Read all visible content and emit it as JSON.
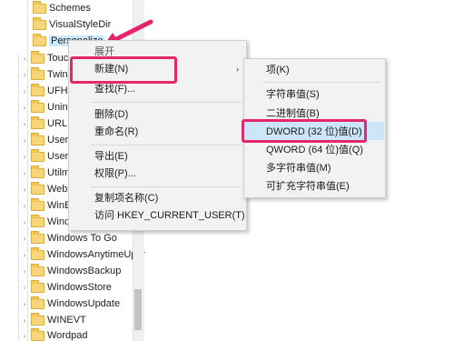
{
  "tree": {
    "items": [
      {
        "label": "Schemes",
        "arrow": ""
      },
      {
        "label": "VisualStyleDir",
        "arrow": ""
      },
      {
        "label": "Personalize",
        "arrow": ""
      },
      {
        "label": "Touch",
        "arrow": "›"
      },
      {
        "label": "TwinU",
        "arrow": "›"
      },
      {
        "label": "UFH",
        "arrow": "›"
      },
      {
        "label": "Uninsta",
        "arrow": "›"
      },
      {
        "label": "URL",
        "arrow": "›"
      },
      {
        "label": "UserPic",
        "arrow": "›"
      },
      {
        "label": "UserSta",
        "arrow": "›"
      },
      {
        "label": "Utilman",
        "arrow": "›"
      },
      {
        "label": "WebCh",
        "arrow": "›"
      },
      {
        "label": "WinBio",
        "arrow": "›"
      },
      {
        "label": "Window",
        "arrow": "›"
      },
      {
        "label": "Windows To Go",
        "arrow": "›"
      },
      {
        "label": "WindowsAnytimeUpgr",
        "arrow": "›"
      },
      {
        "label": "WindowsBackup",
        "arrow": "›"
      },
      {
        "label": "WindowsStore",
        "arrow": "›"
      },
      {
        "label": "WindowsUpdate",
        "arrow": "›"
      },
      {
        "label": "WINEVT",
        "arrow": "›"
      },
      {
        "label": "Wordpad",
        "arrow": "›"
      }
    ]
  },
  "context_menu": {
    "expand": "展开",
    "new": "新建(N)",
    "find": "查找(F)...",
    "delete": "删除(D)",
    "rename": "重命名(R)",
    "export": "导出(E)",
    "permissions": "权限(P)...",
    "copy_key_name": "复制项名称(C)",
    "goto": "访问 HKEY_CURRENT_USER(T)",
    "submenu_arrow": "›"
  },
  "new_submenu": {
    "key": "项(K)",
    "string": "字符串值(S)",
    "binary": "二进制值(B)",
    "dword": "DWORD (32 位)值(D)",
    "qword": "QWORD (64 位)值(Q)",
    "multi_string": "多字符串值(M)",
    "expandable_string": "可扩充字符串值(E)"
  },
  "colors": {
    "highlight_box": "#e4266a",
    "selection": "#cde6f7",
    "menu_bg": "#f2f2f2"
  }
}
